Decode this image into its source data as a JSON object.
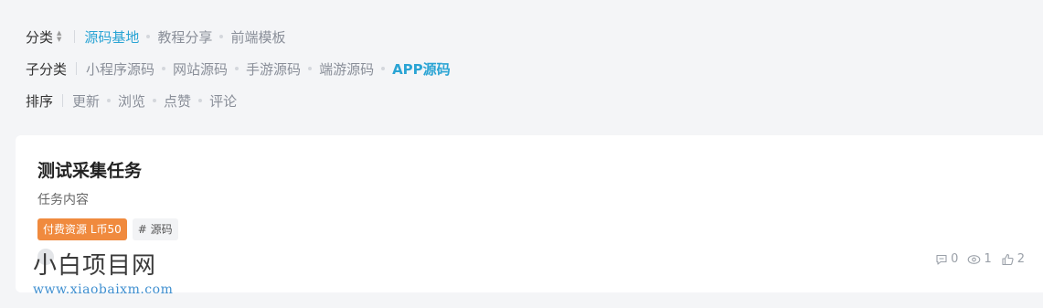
{
  "filters": {
    "category": {
      "label": "分类",
      "options": [
        "源码基地",
        "教程分享",
        "前端模板"
      ]
    },
    "subcategory": {
      "label": "子分类",
      "options": [
        "小程序源码",
        "网站源码",
        "手游源码",
        "端游源码",
        "APP源码"
      ]
    },
    "sort": {
      "label": "排序",
      "options": [
        "更新",
        "浏览",
        "点赞",
        "评论"
      ]
    }
  },
  "post": {
    "title": "测试采集任务",
    "description": "任务内容",
    "tags": {
      "paid": "付费资源 L币50",
      "topic": "# 源码"
    },
    "stats": {
      "comments": "0",
      "views": "1",
      "likes": "2"
    }
  },
  "watermark": {
    "name": "小白项目网",
    "url": "www.xiaobaixm.com"
  },
  "colors": {
    "accent": "#2aa4d4",
    "paid_tag": "#f08a3e",
    "background": "#f4f5f7"
  }
}
